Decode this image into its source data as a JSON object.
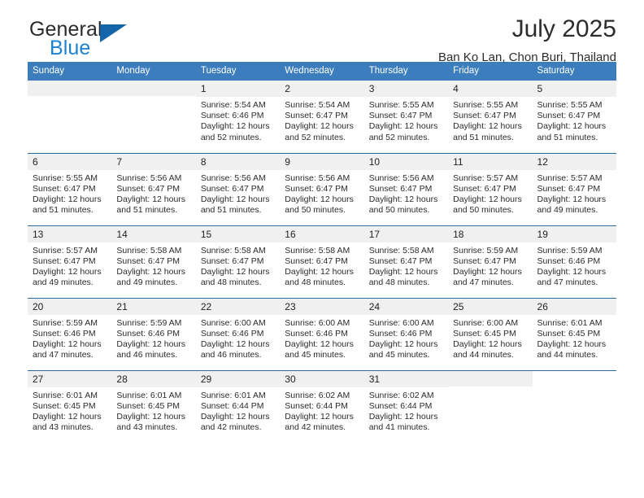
{
  "brand": {
    "line1": "General",
    "line2": "Blue",
    "logo_icon": "triangle-logo-icon",
    "accent_color": "#1d81d1",
    "triangle_color": "#1565ab"
  },
  "header": {
    "title": "July 2025",
    "subtitle": "Ban Ko Lan, Chon Buri, Thailand"
  },
  "theme": {
    "header_blue": "#3b7dbd",
    "row_divider": "#2e6da4",
    "daynum_band": "#f0f0f0"
  },
  "calendar": {
    "weekday_headers": [
      "Sunday",
      "Monday",
      "Tuesday",
      "Wednesday",
      "Thursday",
      "Friday",
      "Saturday"
    ],
    "weeks": [
      [
        {
          "day": "",
          "state": "empty",
          "lines": []
        },
        {
          "day": "",
          "state": "empty",
          "lines": []
        },
        {
          "day": "1",
          "state": "filled",
          "lines": [
            "Sunrise: 5:54 AM",
            "Sunset: 6:46 PM",
            "Daylight: 12 hours",
            "and 52 minutes."
          ]
        },
        {
          "day": "2",
          "state": "filled",
          "lines": [
            "Sunrise: 5:54 AM",
            "Sunset: 6:47 PM",
            "Daylight: 12 hours",
            "and 52 minutes."
          ]
        },
        {
          "day": "3",
          "state": "filled",
          "lines": [
            "Sunrise: 5:55 AM",
            "Sunset: 6:47 PM",
            "Daylight: 12 hours",
            "and 52 minutes."
          ]
        },
        {
          "day": "4",
          "state": "filled",
          "lines": [
            "Sunrise: 5:55 AM",
            "Sunset: 6:47 PM",
            "Daylight: 12 hours",
            "and 51 minutes."
          ]
        },
        {
          "day": "5",
          "state": "filled",
          "lines": [
            "Sunrise: 5:55 AM",
            "Sunset: 6:47 PM",
            "Daylight: 12 hours",
            "and 51 minutes."
          ]
        }
      ],
      [
        {
          "day": "6",
          "state": "filled",
          "lines": [
            "Sunrise: 5:55 AM",
            "Sunset: 6:47 PM",
            "Daylight: 12 hours",
            "and 51 minutes."
          ]
        },
        {
          "day": "7",
          "state": "filled",
          "lines": [
            "Sunrise: 5:56 AM",
            "Sunset: 6:47 PM",
            "Daylight: 12 hours",
            "and 51 minutes."
          ]
        },
        {
          "day": "8",
          "state": "filled",
          "lines": [
            "Sunrise: 5:56 AM",
            "Sunset: 6:47 PM",
            "Daylight: 12 hours",
            "and 51 minutes."
          ]
        },
        {
          "day": "9",
          "state": "filled",
          "lines": [
            "Sunrise: 5:56 AM",
            "Sunset: 6:47 PM",
            "Daylight: 12 hours",
            "and 50 minutes."
          ]
        },
        {
          "day": "10",
          "state": "filled",
          "lines": [
            "Sunrise: 5:56 AM",
            "Sunset: 6:47 PM",
            "Daylight: 12 hours",
            "and 50 minutes."
          ]
        },
        {
          "day": "11",
          "state": "filled",
          "lines": [
            "Sunrise: 5:57 AM",
            "Sunset: 6:47 PM",
            "Daylight: 12 hours",
            "and 50 minutes."
          ]
        },
        {
          "day": "12",
          "state": "filled",
          "lines": [
            "Sunrise: 5:57 AM",
            "Sunset: 6:47 PM",
            "Daylight: 12 hours",
            "and 49 minutes."
          ]
        }
      ],
      [
        {
          "day": "13",
          "state": "filled",
          "lines": [
            "Sunrise: 5:57 AM",
            "Sunset: 6:47 PM",
            "Daylight: 12 hours",
            "and 49 minutes."
          ]
        },
        {
          "day": "14",
          "state": "filled",
          "lines": [
            "Sunrise: 5:58 AM",
            "Sunset: 6:47 PM",
            "Daylight: 12 hours",
            "and 49 minutes."
          ]
        },
        {
          "day": "15",
          "state": "filled",
          "lines": [
            "Sunrise: 5:58 AM",
            "Sunset: 6:47 PM",
            "Daylight: 12 hours",
            "and 48 minutes."
          ]
        },
        {
          "day": "16",
          "state": "filled",
          "lines": [
            "Sunrise: 5:58 AM",
            "Sunset: 6:47 PM",
            "Daylight: 12 hours",
            "and 48 minutes."
          ]
        },
        {
          "day": "17",
          "state": "filled",
          "lines": [
            "Sunrise: 5:58 AM",
            "Sunset: 6:47 PM",
            "Daylight: 12 hours",
            "and 48 minutes."
          ]
        },
        {
          "day": "18",
          "state": "filled",
          "lines": [
            "Sunrise: 5:59 AM",
            "Sunset: 6:47 PM",
            "Daylight: 12 hours",
            "and 47 minutes."
          ]
        },
        {
          "day": "19",
          "state": "filled",
          "lines": [
            "Sunrise: 5:59 AM",
            "Sunset: 6:46 PM",
            "Daylight: 12 hours",
            "and 47 minutes."
          ]
        }
      ],
      [
        {
          "day": "20",
          "state": "filled",
          "lines": [
            "Sunrise: 5:59 AM",
            "Sunset: 6:46 PM",
            "Daylight: 12 hours",
            "and 47 minutes."
          ]
        },
        {
          "day": "21",
          "state": "filled",
          "lines": [
            "Sunrise: 5:59 AM",
            "Sunset: 6:46 PM",
            "Daylight: 12 hours",
            "and 46 minutes."
          ]
        },
        {
          "day": "22",
          "state": "filled",
          "lines": [
            "Sunrise: 6:00 AM",
            "Sunset: 6:46 PM",
            "Daylight: 12 hours",
            "and 46 minutes."
          ]
        },
        {
          "day": "23",
          "state": "filled",
          "lines": [
            "Sunrise: 6:00 AM",
            "Sunset: 6:46 PM",
            "Daylight: 12 hours",
            "and 45 minutes."
          ]
        },
        {
          "day": "24",
          "state": "filled",
          "lines": [
            "Sunrise: 6:00 AM",
            "Sunset: 6:46 PM",
            "Daylight: 12 hours",
            "and 45 minutes."
          ]
        },
        {
          "day": "25",
          "state": "filled",
          "lines": [
            "Sunrise: 6:00 AM",
            "Sunset: 6:45 PM",
            "Daylight: 12 hours",
            "and 44 minutes."
          ]
        },
        {
          "day": "26",
          "state": "filled",
          "lines": [
            "Sunrise: 6:01 AM",
            "Sunset: 6:45 PM",
            "Daylight: 12 hours",
            "and 44 minutes."
          ]
        }
      ],
      [
        {
          "day": "27",
          "state": "filled",
          "lines": [
            "Sunrise: 6:01 AM",
            "Sunset: 6:45 PM",
            "Daylight: 12 hours",
            "and 43 minutes."
          ]
        },
        {
          "day": "28",
          "state": "filled",
          "lines": [
            "Sunrise: 6:01 AM",
            "Sunset: 6:45 PM",
            "Daylight: 12 hours",
            "and 43 minutes."
          ]
        },
        {
          "day": "29",
          "state": "filled",
          "lines": [
            "Sunrise: 6:01 AM",
            "Sunset: 6:44 PM",
            "Daylight: 12 hours",
            "and 42 minutes."
          ]
        },
        {
          "day": "30",
          "state": "filled",
          "lines": [
            "Sunrise: 6:02 AM",
            "Sunset: 6:44 PM",
            "Daylight: 12 hours",
            "and 42 minutes."
          ]
        },
        {
          "day": "31",
          "state": "filled",
          "lines": [
            "Sunrise: 6:02 AM",
            "Sunset: 6:44 PM",
            "Daylight: 12 hours",
            "and 41 minutes."
          ]
        },
        {
          "day": "",
          "state": "empty",
          "lines": []
        },
        {
          "day": "",
          "state": "blank",
          "lines": []
        }
      ]
    ]
  }
}
